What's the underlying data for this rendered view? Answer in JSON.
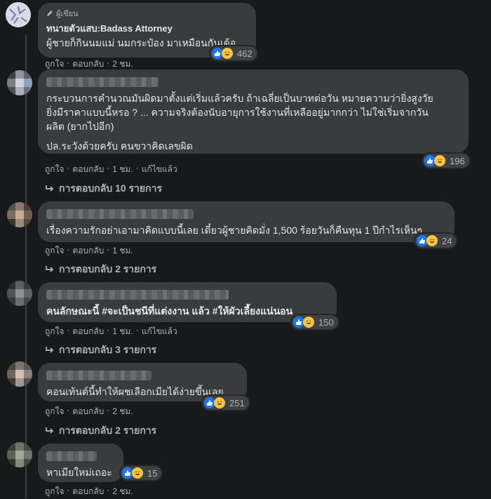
{
  "comments": [
    {
      "badge": "ผู้เขียน",
      "author": "ทนายตัวแสบ:Badass Attorney",
      "lines": [
        "ผู้ชายก็กินนมแม่ นมกระป๋อง มาเหมือนกันเด้อ"
      ],
      "reaction_count": "462",
      "meta": {
        "like": "ถูกใจ",
        "reply": "ตอบกลับ",
        "time": "2 ชม."
      }
    },
    {
      "lines": [
        "กระบวนการคำนวณมันผิดมาตั้งแต่เริ่มแล้วครับ ถ้าเฉลี่ยเป็นบาทต่อวัน หมายความว่ายิ่งสูงวัย",
        "ยิ่งมีราคาแบบนี้หรอ ? ... ความจริงต้องนับอายุการใช้งานที่เหลืออยู่มากกว่า ไม่ใช่เริ่มจากวัน",
        "ผลิต (ยากไปอีก)",
        "ปล.ระวังด้วยครับ คนขวาคิดเลขผิด"
      ],
      "reaction_count": "196",
      "meta": {
        "like": "ถูกใจ",
        "reply": "ตอบกลับ",
        "time": "1 ชม.",
        "edited": "แก้ไขแล้ว"
      },
      "replies": "การตอบกลับ 10 รายการ"
    },
    {
      "lines": [
        "เรื่องความรักอย่าเอามาคิดแบบนี้เลย เดี๋ยวผู้ชายคิดมั่ง 1,500 ร้อยวันก็คืนทุน 1 ปีกำไรเห็นๆ"
      ],
      "reaction_count": "24",
      "meta": {
        "like": "ถูกใจ",
        "reply": "ตอบกลับ",
        "time": "1 ชม."
      },
      "replies": "การตอบกลับ 2 รายการ"
    },
    {
      "lines": [
        "คนลักษณะนี้ #จะเป็นชนีที่แต่งงาน แล้ว #ให้ผัวเลี้ยงแน่นอน"
      ],
      "reaction_count": "150",
      "meta": {
        "like": "ถูกใจ",
        "reply": "ตอบกลับ",
        "time": "1 ชม.",
        "edited": "แก้ไขแล้ว"
      },
      "replies": "การตอบกลับ 3 รายการ"
    },
    {
      "lines": [
        "คอนเท้นต์นี้ทำให้ผชเลือกเมียได้ง่ายขึ้นเลย"
      ],
      "reaction_count": "251",
      "meta": {
        "like": "ถูกใจ",
        "reply": "ตอบกลับ",
        "time": "2 ชม."
      },
      "replies": "การตอบกลับ 2 รายการ"
    },
    {
      "lines": [
        "หาเมียใหม่เถอะ"
      ],
      "reaction_count": "15",
      "meta": {
        "like": "ถูกใจ",
        "reply": "ตอบกลับ",
        "time": "2 ชม."
      }
    }
  ],
  "colors": {
    "background": "#18191a",
    "bubble": "#3a3b3c",
    "like_blue": "#1877f2",
    "haha_yellow": "#f7c53f",
    "muted": "#b0b3b8"
  },
  "icons": [
    "pencil-icon",
    "like-reaction-icon",
    "haha-reaction-icon",
    "reply-arrow-icon"
  ]
}
